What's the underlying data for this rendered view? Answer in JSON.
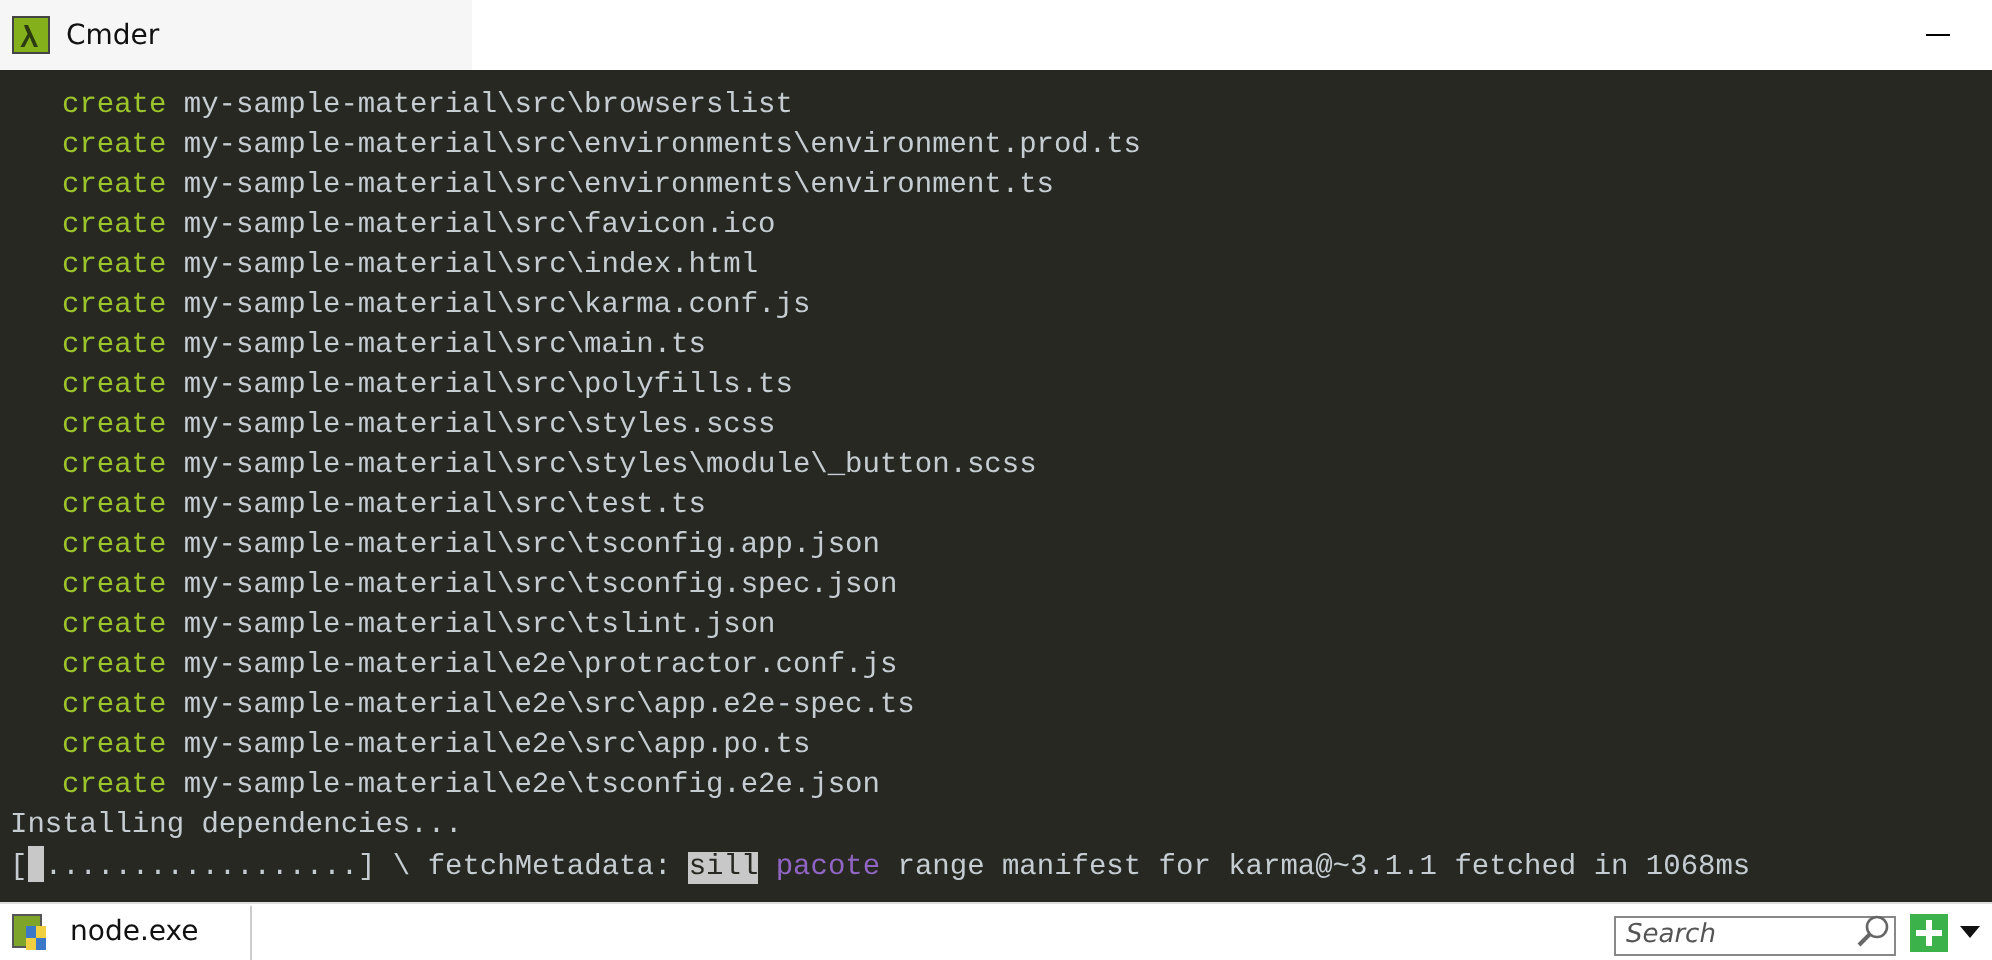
{
  "window": {
    "title": "Cmder"
  },
  "terminal": {
    "lines": [
      {
        "keyword": "create",
        "path": "my-sample-material\\src\\browserslist"
      },
      {
        "keyword": "create",
        "path": "my-sample-material\\src\\environments\\environment.prod.ts"
      },
      {
        "keyword": "create",
        "path": "my-sample-material\\src\\environments\\environment.ts"
      },
      {
        "keyword": "create",
        "path": "my-sample-material\\src\\favicon.ico"
      },
      {
        "keyword": "create",
        "path": "my-sample-material\\src\\index.html"
      },
      {
        "keyword": "create",
        "path": "my-sample-material\\src\\karma.conf.js"
      },
      {
        "keyword": "create",
        "path": "my-sample-material\\src\\main.ts"
      },
      {
        "keyword": "create",
        "path": "my-sample-material\\src\\polyfills.ts"
      },
      {
        "keyword": "create",
        "path": "my-sample-material\\src\\styles.scss"
      },
      {
        "keyword": "create",
        "path": "my-sample-material\\src\\styles\\module\\_button.scss"
      },
      {
        "keyword": "create",
        "path": "my-sample-material\\src\\test.ts"
      },
      {
        "keyword": "create",
        "path": "my-sample-material\\src\\tsconfig.app.json"
      },
      {
        "keyword": "create",
        "path": "my-sample-material\\src\\tsconfig.spec.json"
      },
      {
        "keyword": "create",
        "path": "my-sample-material\\src\\tslint.json"
      },
      {
        "keyword": "create",
        "path": "my-sample-material\\e2e\\protractor.conf.js"
      },
      {
        "keyword": "create",
        "path": "my-sample-material\\e2e\\src\\app.e2e-spec.ts"
      },
      {
        "keyword": "create",
        "path": "my-sample-material\\e2e\\src\\app.po.ts"
      },
      {
        "keyword": "create",
        "path": "my-sample-material\\e2e\\tsconfig.e2e.json"
      }
    ],
    "status": "Installing dependencies...",
    "progress": [
      {
        "kind": "plain",
        "text": "["
      },
      {
        "kind": "cursor"
      },
      {
        "kind": "plain",
        "text": "..................] \\ fetchMetadata: "
      },
      {
        "kind": "highlight",
        "text": "sill"
      },
      {
        "kind": "keyword",
        "text": "pacote"
      },
      {
        "kind": "plain",
        "text": " range manifest for karma@~3.1.1 fetched in 1068ms"
      }
    ]
  },
  "taskbar": {
    "tabs": [
      {
        "label": "node.exe",
        "selected": true
      }
    ],
    "search": {
      "placeholder": "Search"
    }
  }
}
